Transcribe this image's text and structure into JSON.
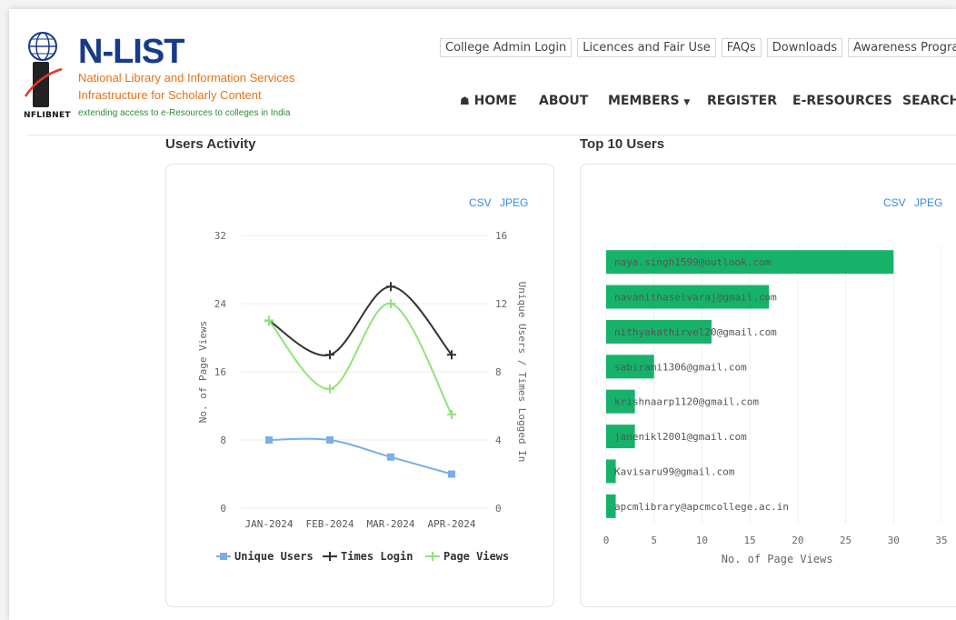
{
  "brand": {
    "name": "N-LIST",
    "subtitle_line1": "National Library and Information Services",
    "subtitle_line2": "Infrastructure for Scholarly Content",
    "tagline": "extending access to e-Resources to colleges in India",
    "logo_abbr": "NFLIBNET"
  },
  "top_links": [
    "College Admin Login",
    "Licences and Fair Use",
    "FAQs",
    "Downloads",
    "Awareness Programme"
  ],
  "nav": {
    "home": "HOME",
    "about": "ABOUT",
    "members": "MEMBERS",
    "register": "REGISTER",
    "eresources": "E-RESOURCES",
    "search": "SEARCH"
  },
  "sections": {
    "activity_title": "Users Activity",
    "top_title": "Top 10 Users"
  },
  "exports": {
    "csv": "CSV",
    "jpeg": "JPEG"
  },
  "chart_data": [
    {
      "type": "line",
      "categories": [
        "JAN-2024",
        "FEB-2024",
        "MAR-2024",
        "APR-2024"
      ],
      "ylabel_left": "No. of Page Views",
      "ylabel_right": "Unique Users / Times Logged In",
      "ylim_left": [
        0,
        32
      ],
      "ylim_right": [
        0,
        16
      ],
      "yticks_left": [
        "0",
        "8",
        "16",
        "24",
        "32"
      ],
      "yticks_right": [
        "0",
        "4",
        "8",
        "12",
        "16"
      ],
      "series": [
        {
          "name": "Unique Users",
          "axis": "right",
          "color": "#7aaee6",
          "marker": "square",
          "values": [
            4,
            4,
            3,
            2
          ]
        },
        {
          "name": "Times Login",
          "axis": "right",
          "color": "#333333",
          "marker": "plus",
          "values": [
            11,
            9,
            13,
            9
          ]
        },
        {
          "name": "Page Views",
          "axis": "left",
          "color": "#8fe37a",
          "marker": "plus",
          "values": [
            22,
            14,
            24,
            11
          ]
        }
      ],
      "legend": "bottom"
    },
    {
      "type": "bar",
      "orientation": "horizontal",
      "categories": [
        "naya.singh1599@outlook.com",
        "navanithaselvaraj@gmail.com",
        "nithyakathirvel20@gmail.com",
        "sabirami1306@gmail.com",
        "krishnaarp1120@gmail.com",
        "janenikl2001@gmail.com",
        "Kavisaru99@gmail.com",
        "apcmlibrary@apcmcollege.ac.in"
      ],
      "values": [
        30,
        17,
        11,
        5,
        3,
        3,
        1,
        1
      ],
      "xlabel": "No. of Page Views",
      "xlim": [
        0,
        35
      ],
      "xticks": [
        "0",
        "5",
        "10",
        "15",
        "20",
        "25",
        "30",
        "35"
      ],
      "color": "#17b26a"
    }
  ]
}
